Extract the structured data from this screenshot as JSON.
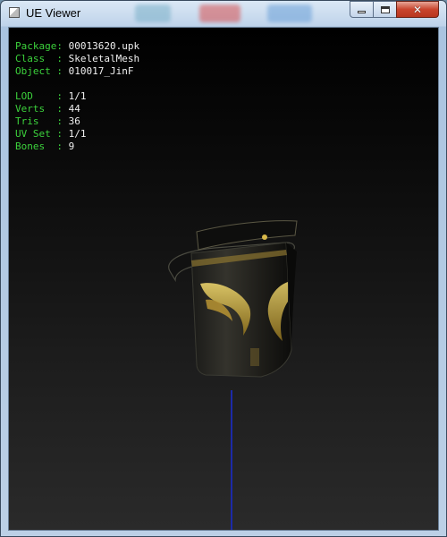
{
  "window": {
    "title": "UE Viewer",
    "close_glyph": "✕"
  },
  "info": {
    "rows": [
      {
        "label": "Package:",
        "value": "00013620.upk"
      },
      {
        "label": "Class  :",
        "value": "SkeletalMesh"
      },
      {
        "label": "Object :",
        "value": "010017_JinF"
      },
      {
        "label": "LOD    :",
        "value": "1/1"
      },
      {
        "label": "Verts  :",
        "value": "44"
      },
      {
        "label": "Tris   :",
        "value": "36"
      },
      {
        "label": "UV Set :",
        "value": "1/1"
      },
      {
        "label": "Bones  :",
        "value": "9"
      }
    ]
  },
  "colors": {
    "label_green": "#3cd23c",
    "value_white": "#f0f0f0",
    "mesh_gold": "#c9a93a",
    "axis_blue": "#1c2aa8"
  },
  "icons": {
    "app": "ue-viewer-app-icon",
    "minimize": "minimize-icon",
    "maximize": "maximize-icon",
    "close": "close-icon"
  }
}
